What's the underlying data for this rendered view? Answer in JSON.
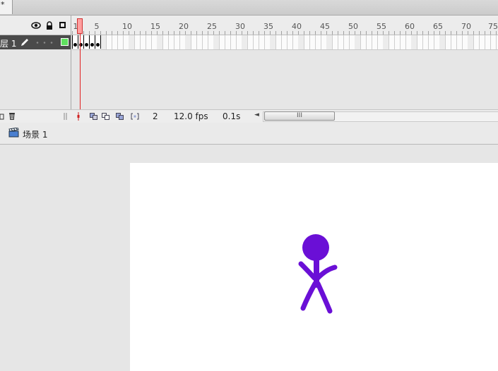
{
  "document": {
    "tab_label": "*"
  },
  "timeline": {
    "ruler_ticks": [
      "1",
      "5",
      "10",
      "15",
      "20",
      "25",
      "30",
      "35",
      "40",
      "45",
      "50",
      "55",
      "60",
      "65",
      "70",
      "75"
    ],
    "layer": {
      "name": "层 1",
      "color": "#5ee05e"
    },
    "current_frame": "2",
    "frame_rate": "12.0 fps",
    "elapsed": "0.1s",
    "scroll_thumb_grip": "III"
  },
  "scene": {
    "label": "场景 1"
  },
  "stage": {
    "figure_color": "#6a0fd6",
    "background": "#ffffff"
  }
}
